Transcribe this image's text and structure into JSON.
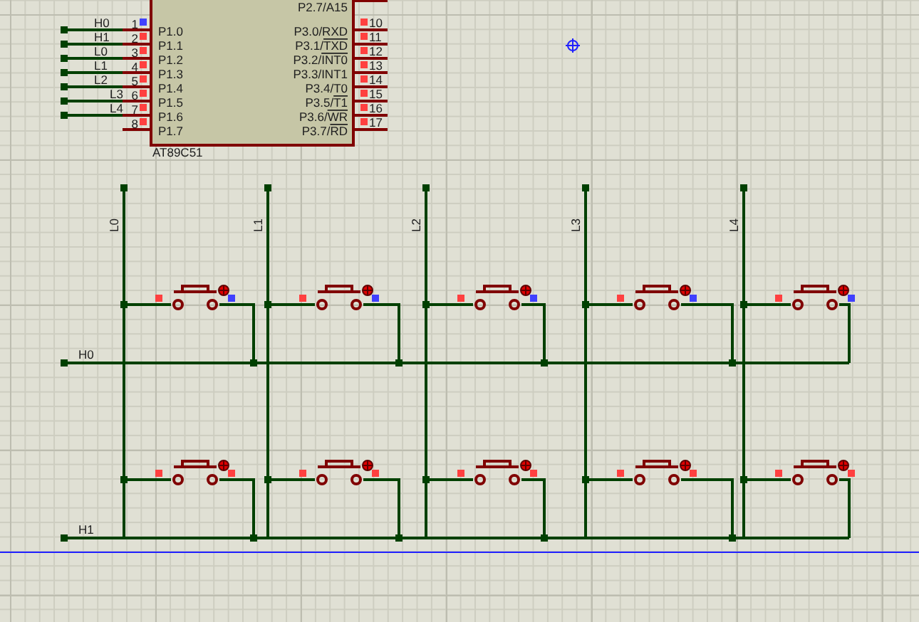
{
  "schematic": {
    "chip": {
      "part": "AT89C51",
      "top_pin_label": "P2.7/A15",
      "left_pins": [
        {
          "number": "1",
          "label": "P1.0",
          "net": "H0",
          "high": false
        },
        {
          "number": "2",
          "label": "P1.1",
          "net": "H1",
          "high": true
        },
        {
          "number": "3",
          "label": "P1.2",
          "net": "L0",
          "high": true
        },
        {
          "number": "4",
          "label": "P1.3",
          "net": "L1",
          "high": true
        },
        {
          "number": "5",
          "label": "P1.4",
          "net": "L2",
          "high": true
        },
        {
          "number": "6",
          "label": "P1.5",
          "net": "L3",
          "high": true
        },
        {
          "number": "7",
          "label": "P1.6",
          "net": "L4",
          "high": true
        },
        {
          "number": "8",
          "label": "P1.7",
          "high": true
        }
      ],
      "right_pins": [
        {
          "number": "10",
          "label": "P3.0/RXD",
          "high": true
        },
        {
          "number": "11",
          "label": "P3.1/",
          "overlined": "TXD",
          "high": true
        },
        {
          "number": "12",
          "label": "P3.2/",
          "overlined": "INT0",
          "high": true
        },
        {
          "number": "13",
          "label": "P3.3/INT1",
          "high": true
        },
        {
          "number": "14",
          "label": "P3.4/T0",
          "high": true
        },
        {
          "number": "15",
          "label": "P3.5/",
          "overlined": "T1",
          "high": true
        },
        {
          "number": "16",
          "label": "P3.6/",
          "overlined": "WR",
          "high": true
        },
        {
          "number": "17",
          "label": "P3.7/",
          "overlined": "RD",
          "high": true
        }
      ]
    },
    "columns": [
      {
        "net": "L0"
      },
      {
        "net": "L1"
      },
      {
        "net": "L2"
      },
      {
        "net": "L3"
      },
      {
        "net": "L4"
      }
    ],
    "rows": [
      {
        "net": "H0",
        "buttons": [
          {
            "left_high": true,
            "right_high": false
          },
          {
            "left_high": true,
            "right_high": false
          },
          {
            "left_high": true,
            "right_high": false
          },
          {
            "left_high": true,
            "right_high": false
          },
          {
            "left_high": true,
            "right_high": false
          }
        ]
      },
      {
        "net": "H1",
        "buttons": [
          {
            "left_high": true,
            "right_high": true
          },
          {
            "left_high": true,
            "right_high": true
          },
          {
            "left_high": true,
            "right_high": true
          },
          {
            "left_high": true,
            "right_high": true
          },
          {
            "left_high": true,
            "right_high": true
          }
        ]
      }
    ]
  }
}
